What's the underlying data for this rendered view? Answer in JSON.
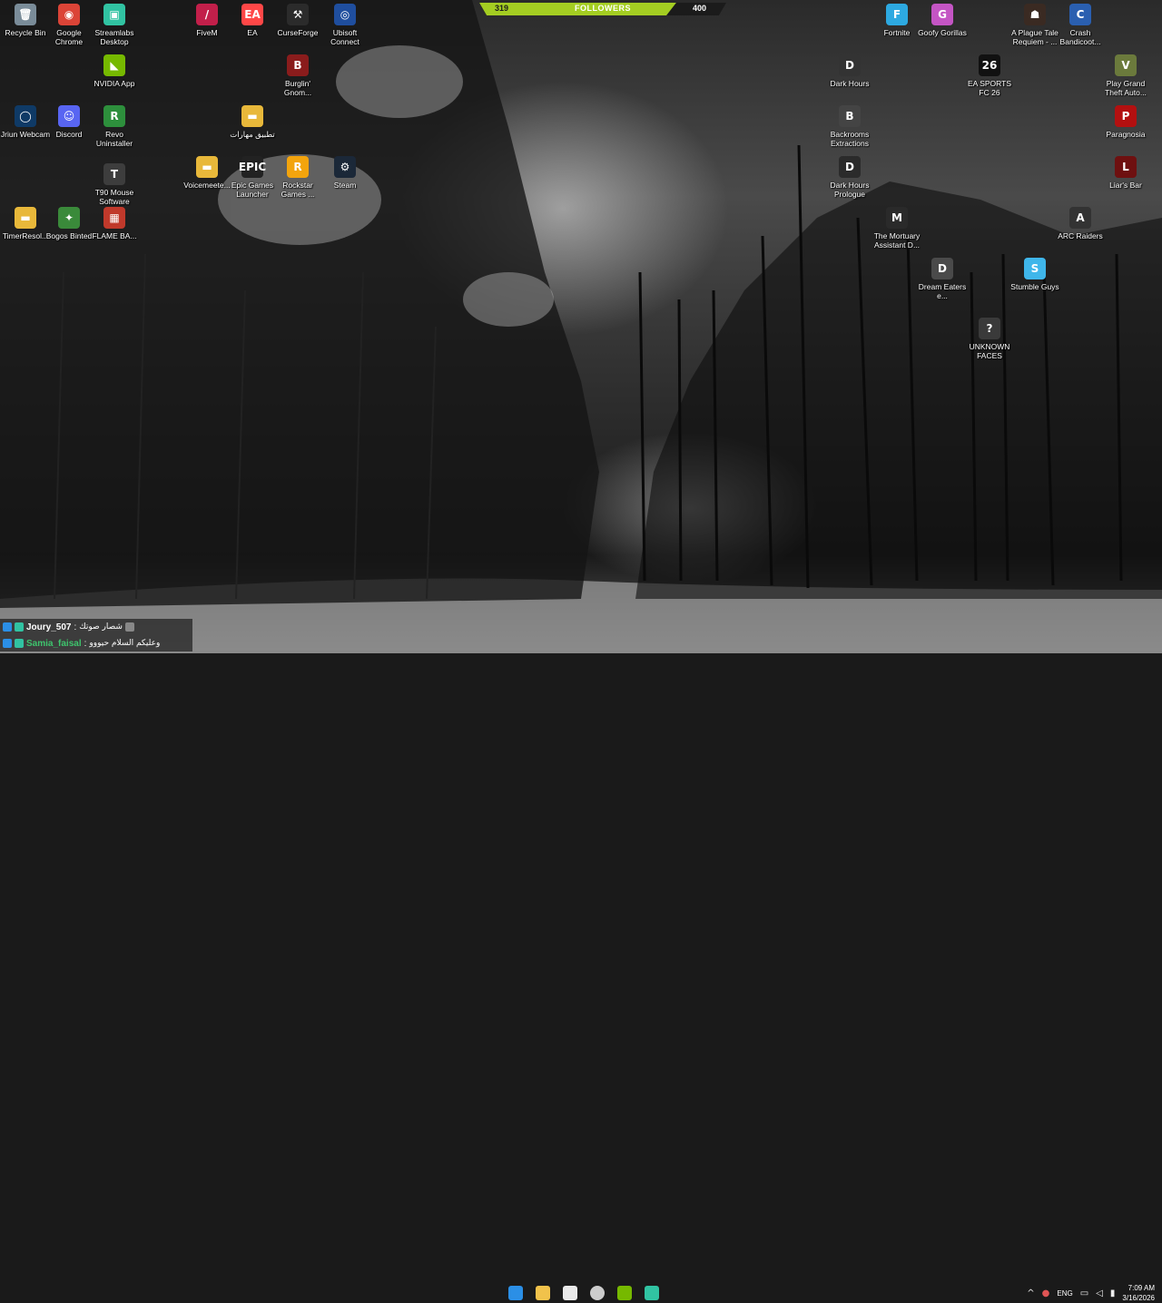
{
  "followers": {
    "current": "319",
    "title": "FOLLOWERS",
    "goal": "400",
    "progress": 0.7975
  },
  "icons": [
    {
      "label": "Recycle Bin",
      "glyph": "🗑",
      "color": "#7a8c99"
    },
    {
      "label": "Google Chrome",
      "glyph": "◉",
      "color": "#db4437"
    },
    {
      "label": "Streamlabs Desktop",
      "glyph": "▣",
      "color": "#31c3a2"
    },
    {
      "label": "FiveM",
      "glyph": "/",
      "color": "#c21f4a"
    },
    {
      "label": "EA",
      "glyph": "EA",
      "color": "#ff4747"
    },
    {
      "label": "CurseForge",
      "glyph": "⚒",
      "color": "#2b2b2b"
    },
    {
      "label": "Ubisoft Connect",
      "glyph": "◎",
      "color": "#1f4e9e"
    },
    {
      "label": "Fortnite",
      "glyph": "F",
      "color": "#2da9e1"
    },
    {
      "label": "Goofy Gorillas",
      "glyph": "G",
      "color": "#c455c4"
    },
    {
      "label": "A Plague Tale Requiem - ...",
      "glyph": "☗",
      "color": "#3a2a22"
    },
    {
      "label": "Crash Bandicoot...",
      "glyph": "C",
      "color": "#2a5fb0"
    },
    {
      "label": "NVIDIA App",
      "glyph": "◣",
      "color": "#76b900"
    },
    {
      "label": "Burglin' Gnom...",
      "glyph": "B",
      "color": "#8a1c1c"
    },
    {
      "label": "Dark Hours",
      "glyph": "D",
      "color": "#333"
    },
    {
      "label": "EA SPORTS FC 26",
      "glyph": "26",
      "color": "#111"
    },
    {
      "label": "Play Grand Theft Auto...",
      "glyph": "V",
      "color": "#6b7a3c"
    },
    {
      "label": "Jriun Webcam",
      "glyph": "◯",
      "color": "#0f3a66"
    },
    {
      "label": "Discord",
      "glyph": "☺",
      "color": "#5865f2"
    },
    {
      "label": "Revo Uninstaller",
      "glyph": "R",
      "color": "#2d8f3c"
    },
    {
      "label": "تطبيق مهارات",
      "glyph": "▬",
      "color": "#e8b83a"
    },
    {
      "label": "Backrooms Extractions",
      "glyph": "B",
      "color": "#444"
    },
    {
      "label": "Paragnosia",
      "glyph": "P",
      "color": "#b31010"
    },
    {
      "label": "Voicemeete...",
      "glyph": "▬",
      "color": "#e8b83a"
    },
    {
      "label": "Epic Games Launcher",
      "glyph": "EPIC",
      "color": "#222"
    },
    {
      "label": "Rockstar Games ...",
      "glyph": "R",
      "color": "#f3a40d"
    },
    {
      "label": "Steam",
      "glyph": "⚙",
      "color": "#1b2838"
    },
    {
      "label": "Dark Hours Prologue",
      "glyph": "D",
      "color": "#2b2b2b"
    },
    {
      "label": "Liar's Bar",
      "glyph": "L",
      "color": "#6e1010"
    },
    {
      "label": "T90 Mouse Software",
      "glyph": "T",
      "color": "#3d3d3d"
    },
    {
      "label": "The Mortuary Assistant D...",
      "glyph": "M",
      "color": "#2a2a2a"
    },
    {
      "label": "ARC Raiders",
      "glyph": "A",
      "color": "#333"
    },
    {
      "label": "TimerResol...",
      "glyph": "▬",
      "color": "#e8b83a"
    },
    {
      "label": "Bogos Binted",
      "glyph": "✦",
      "color": "#3a8a3a"
    },
    {
      "label": "FLAME BA...",
      "glyph": "▦",
      "color": "#c0392b"
    },
    {
      "label": "Dream Eaters e...",
      "glyph": "D",
      "color": "#4a4a4a"
    },
    {
      "label": "Stumble Guys",
      "glyph": "S",
      "color": "#3fb6ea"
    },
    {
      "label": "UNKNOWN FACES",
      "glyph": "?",
      "color": "#3a3a3a"
    }
  ],
  "chat": [
    {
      "user": "Joury_507",
      "sep": ":",
      "message": "شصار صوتك",
      "user_color": "#f0f0f0"
    },
    {
      "user": "Samia_faisal",
      "sep": ":",
      "message": "وعليكم السلام حيووو",
      "user_color": "#3ec46d"
    }
  ],
  "taskbar": {
    "apps": [
      {
        "name": "start",
        "color": "#2b8fe6"
      },
      {
        "name": "file-explorer",
        "color": "#f1c24b"
      },
      {
        "name": "store",
        "color": "#e9e9e9"
      },
      {
        "name": "obs",
        "color": "#cccccc"
      },
      {
        "name": "nvidia",
        "color": "#76b900"
      },
      {
        "name": "streamlabs",
        "color": "#31c3a2"
      }
    ]
  },
  "tray": {
    "language": "ENG",
    "time": "7:09 AM",
    "date": "3/16/2026",
    "up_arrow": "^"
  }
}
